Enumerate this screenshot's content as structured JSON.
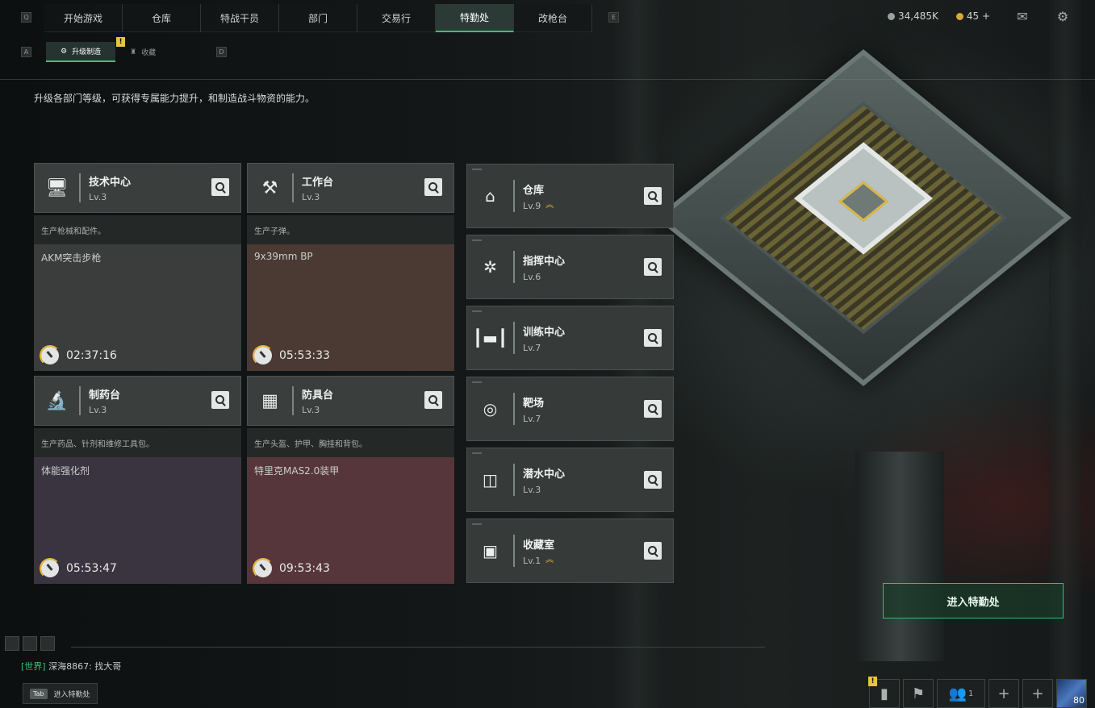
{
  "nav": {
    "tabs": [
      "开始游戏",
      "仓库",
      "特战干员",
      "部门",
      "交易行",
      "特勤处",
      "改枪台"
    ],
    "active": "特勤处",
    "key_left": "Q",
    "key_right": "E"
  },
  "resources": {
    "coins": "34,485K",
    "premium": "45 +"
  },
  "subnav": {
    "tabs": [
      "升级制造",
      "收藏"
    ],
    "key_left": "A",
    "key_right": "D"
  },
  "description": "升级各部门等级，可获得专属能力提升，和制造战斗物资的能力。",
  "workstations": [
    {
      "name": "技术中心",
      "level": "Lv.3",
      "desc": "生产枪械和配件。",
      "item": "AKM突击步枪",
      "timer": "02:37:16",
      "icon": "monitor-icon",
      "bg": "#3a3d3c"
    },
    {
      "name": "工作台",
      "level": "Lv.3",
      "desc": "生产子弹。",
      "item": "9x39mm BP",
      "timer": "05:53:33",
      "icon": "tools-icon",
      "bg": "#4a3a33"
    },
    {
      "name": "制药台",
      "level": "Lv.3",
      "desc": "生产药品、针剂和维修工具包。",
      "item": "体能强化剂",
      "timer": "05:53:47",
      "icon": "microscope-icon",
      "bg": "#3a3440"
    },
    {
      "name": "防具台",
      "level": "Lv.3",
      "desc": "生产头盔、护甲、胸挂和背包。",
      "item": "特里克MAS2.0装甲",
      "timer": "09:53:43",
      "icon": "armor-blocks-icon",
      "bg": "#56363a"
    }
  ],
  "departments": [
    {
      "name": "仓库",
      "level": "Lv.9",
      "upgrade": true,
      "icon": "warehouse-icon"
    },
    {
      "name": "指挥中心",
      "level": "Lv.6",
      "upgrade": false,
      "icon": "command-icon"
    },
    {
      "name": "训练中心",
      "level": "Lv.7",
      "upgrade": false,
      "icon": "dumbbell-icon"
    },
    {
      "name": "靶场",
      "level": "Lv.7",
      "upgrade": false,
      "icon": "target-icon"
    },
    {
      "name": "潜水中心",
      "level": "Lv.3",
      "upgrade": false,
      "icon": "diving-mask-icon"
    },
    {
      "name": "收藏室",
      "level": "Lv.1",
      "upgrade": true,
      "icon": "collection-icon"
    }
  ],
  "enter_button": "进入特勤处",
  "chat": {
    "channel": "[世界]",
    "user": "深海8867:",
    "message": "找大哥"
  },
  "tab_hint": {
    "key": "Tab",
    "label": "进入特勤处"
  },
  "bottom": {
    "friends_count": "1",
    "avatar_level": "80"
  },
  "colors": {
    "accent": "#35c47a",
    "warning": "#e8c63c",
    "upgrade": "#e2b53b"
  }
}
